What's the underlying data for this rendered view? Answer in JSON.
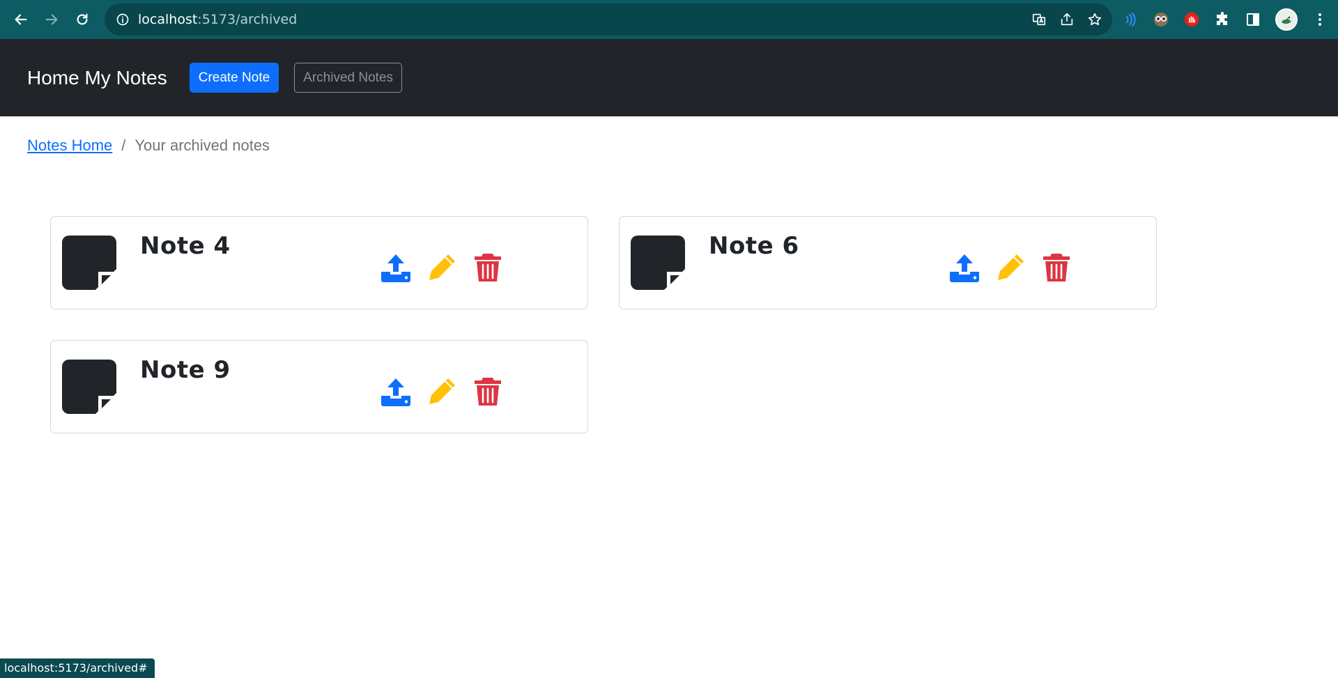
{
  "browser": {
    "url_host": "localhost",
    "url_path": ":5173/archived",
    "status_url": "localhost:5173/archived#"
  },
  "navbar": {
    "brand": "Home My Notes",
    "create_label": "Create Note",
    "archived_label": "Archived Notes"
  },
  "breadcrumb": {
    "home_label": "Notes Home",
    "separator": "/",
    "current_label": "Your archived notes"
  },
  "notes": [
    {
      "title": "Note 4"
    },
    {
      "title": "Note 6"
    },
    {
      "title": "Note 9"
    }
  ],
  "colors": {
    "chrome": "#0d5c63",
    "navbar": "#212529",
    "primary": "#0d6efd",
    "unarchive": "#0d6efd",
    "edit": "#ffc107",
    "delete": "#dc3545"
  },
  "icons": {
    "unarchive": "upload-icon",
    "edit": "pencil-icon",
    "delete": "trash-icon",
    "note": "sticky-note-icon"
  }
}
